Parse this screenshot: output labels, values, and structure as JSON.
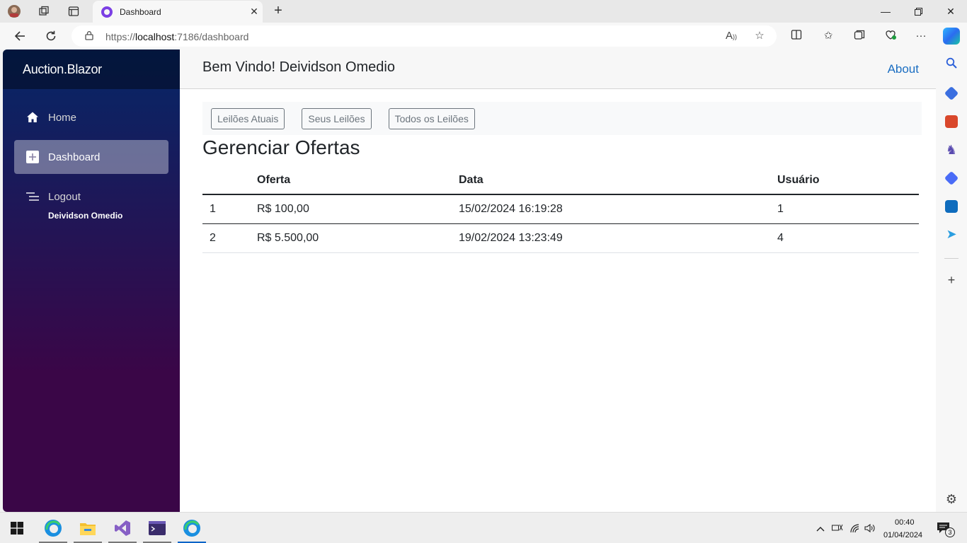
{
  "browser": {
    "tab_title": "Dashboard",
    "url_scheme": "https://",
    "url_host": "localhost",
    "url_path": ":7186/dashboard"
  },
  "app": {
    "brand": "Auction.Blazor",
    "nav": [
      {
        "label": "Home",
        "icon": "home-icon"
      },
      {
        "label": "Dashboard",
        "icon": "plus-square-icon"
      },
      {
        "label": "Logout",
        "icon": "menu-lines-icon"
      }
    ],
    "user_name": "Deividson Omedio",
    "welcome": "Bem Vindo! Deividson Omedio",
    "about_link": "About",
    "buttons": [
      "Leilões Atuais",
      "Seus Leilões",
      "Todos os Leilões"
    ],
    "page_title": "Gerenciar Ofertas",
    "table": {
      "headers": [
        "",
        "Oferta",
        "Data",
        "Usuário"
      ],
      "rows": [
        [
          "1",
          "R$ 100,00",
          "15/02/2024 16:19:28",
          "1"
        ],
        [
          "2",
          "R$ 5.500,00",
          "19/02/2024 13:23:49",
          "4"
        ]
      ]
    }
  },
  "taskbar": {
    "time": "00:40",
    "date": "01/04/2024",
    "notifications": "3"
  },
  "colors": {
    "sidebar_top": "#052767",
    "sidebar_bottom": "#3a0647",
    "link": "#1b6ec2",
    "accent": "#0a64c8"
  }
}
